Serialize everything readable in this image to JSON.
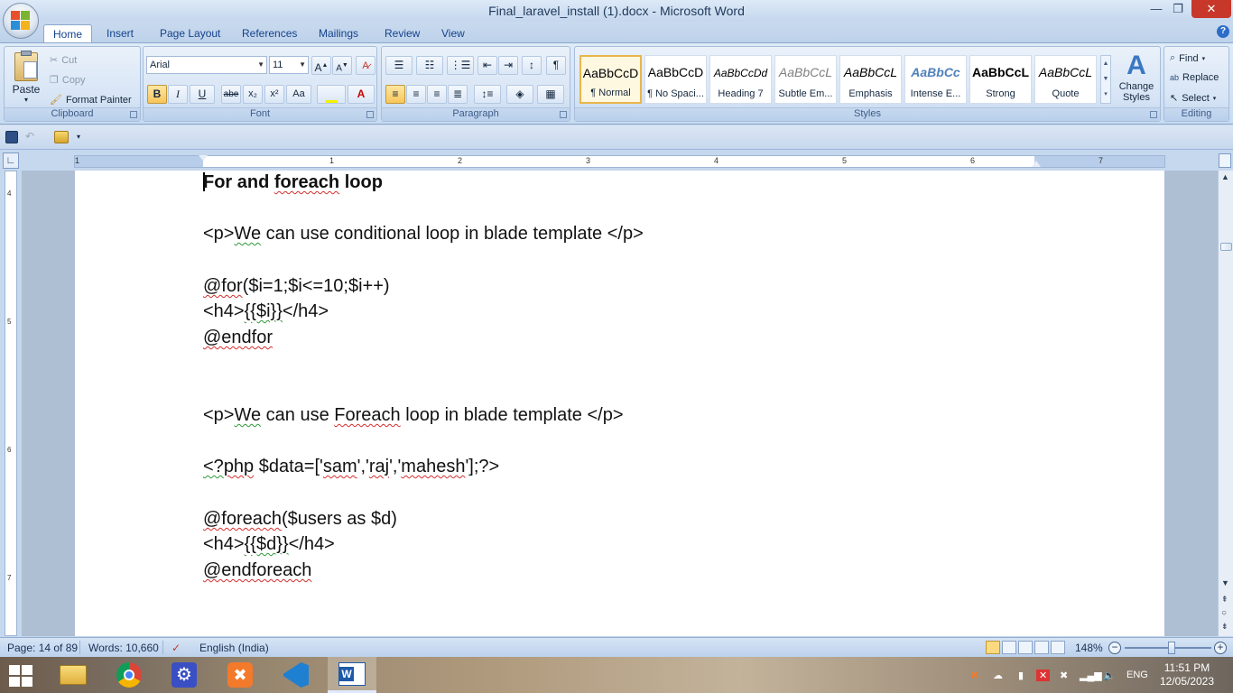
{
  "window": {
    "title": "Final_laravel_install (1).docx - Microsoft Word",
    "min": "—",
    "max": "❐",
    "close": "✕"
  },
  "tabs": [
    "Home",
    "Insert",
    "Page Layout",
    "References",
    "Mailings",
    "Review",
    "View"
  ],
  "clipboard": {
    "paste": "Paste",
    "cut": "Cut",
    "copy": "Copy",
    "format_painter": "Format Painter",
    "label": "Clipboard"
  },
  "font": {
    "name": "Arial",
    "size": "11",
    "label": "Font",
    "bold": "B",
    "italic": "I",
    "underline": "U",
    "strike": "abe",
    "sub": "x₂",
    "sup": "x²",
    "case": "Aa",
    "grow": "A",
    "shrink": "A"
  },
  "paragraph": {
    "label": "Paragraph",
    "pilcrow": "¶"
  },
  "styles": {
    "label": "Styles",
    "items": [
      {
        "sample": "AaBbCcD",
        "name": "¶ Normal"
      },
      {
        "sample": "AaBbCcD",
        "name": "¶ No Spaci..."
      },
      {
        "sample": "AaBbCcDd",
        "name": "Heading 7"
      },
      {
        "sample": "AaBbCcL",
        "name": "Subtle Em..."
      },
      {
        "sample": "AaBbCcL",
        "name": "Emphasis"
      },
      {
        "sample": "AaBbCc",
        "name": "Intense E..."
      },
      {
        "sample": "AaBbCcL",
        "name": "Strong"
      },
      {
        "sample": "AaBbCcL",
        "name": "Quote"
      }
    ],
    "change_styles_1": "Change",
    "change_styles_2": "Styles"
  },
  "editing": {
    "label": "Editing",
    "find": "Find",
    "replace": "Replace",
    "select": "Select"
  },
  "ruler": {
    "numbers": [
      "1",
      "1",
      "2",
      "3",
      "4",
      "5",
      "6",
      "7"
    ],
    "vnumbers": [
      "4",
      "5",
      "6",
      "7"
    ]
  },
  "document": {
    "heading": {
      "p1": "For and ",
      "p2": "foreach",
      "p3": " loop"
    },
    "line1": {
      "a": "<p>",
      "b": "We",
      "c": " can use conditional loop in blade template </p>"
    },
    "line2": {
      "a": "@for",
      "b": "($i=1;$i<=10;$i++)"
    },
    "line3": {
      "a": "<h4>",
      "b": "{{$i}}",
      "c": "</h4>"
    },
    "line4": {
      "a": "@endfor"
    },
    "line5": {
      "a": "<p>",
      "b": "We",
      "c": " can use ",
      "d": "Foreach",
      "e": " loop in blade template </p>"
    },
    "line6": {
      "a": "<?",
      "b": "php",
      "c": " $data=['",
      "d": "sam",
      "e": "','",
      "f": "raj",
      "g": "','",
      "h": "mahesh",
      "i": "'];?>"
    },
    "line7": {
      "a": "@foreach",
      "b": "($users as $d)"
    },
    "line8": {
      "a": "<h4>",
      "b": "{{$d}}",
      "c": "</h4>"
    },
    "line9": {
      "a": "@endforeach"
    }
  },
  "status": {
    "page": "Page: 14 of 89",
    "words": "Words: 10,660",
    "language": "English (India)",
    "zoom": "148%"
  },
  "taskbar": {
    "lang": "ENG",
    "time": "11:51 PM",
    "date": "12/05/2023"
  }
}
